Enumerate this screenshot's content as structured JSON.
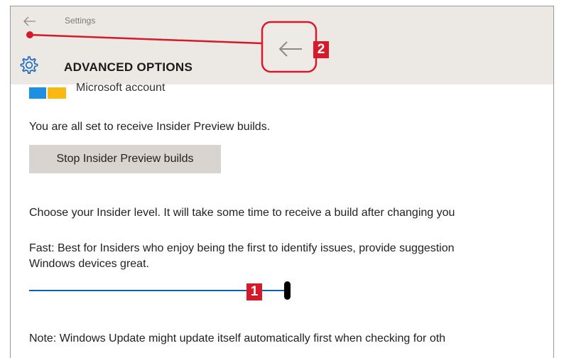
{
  "window": {
    "title": "Settings",
    "back_icon": "back-arrow-icon"
  },
  "header": {
    "icon": "gear-icon",
    "title": "ADVANCED OPTIONS"
  },
  "account": {
    "logo_icon": "microsoft-logo-icon",
    "label": "Microsoft account"
  },
  "insider": {
    "status_text": "You are all set to receive Insider Preview builds.",
    "stop_button_label": "Stop Insider Preview builds",
    "level_prompt": "Choose your Insider level. It will take some time to receive a build after changing you",
    "level_description_line1": " Fast: Best for Insiders who enjoy being the first to identify issues, provide suggestion",
    "level_description_line2": "Windows devices great.",
    "level_slider_value": 1.0,
    "note": "Note: Windows Update might update itself automatically first when checking for oth"
  },
  "callouts": {
    "badge1": "1",
    "badge2": "2",
    "color": "#d61a2a"
  }
}
